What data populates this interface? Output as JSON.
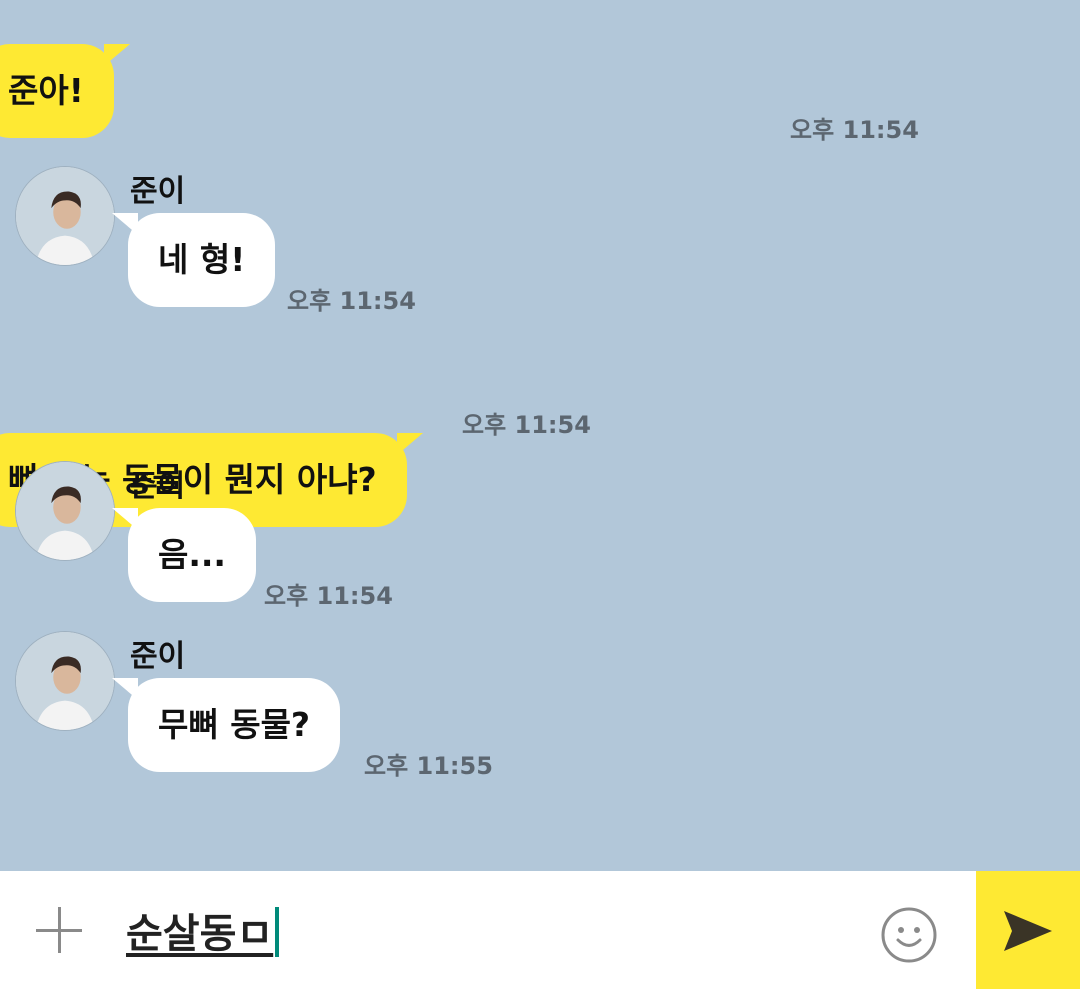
{
  "messages": [
    {
      "dir": "out",
      "text": "준아!",
      "time": "오후 11:54"
    },
    {
      "dir": "in",
      "sender": "준이",
      "text": "네 형!",
      "time": "오후 11:54"
    },
    {
      "dir": "out",
      "text": "뼈 없는 동물이 뭔지 아냐?",
      "time": "오후 11:54"
    },
    {
      "dir": "in",
      "sender": "준이",
      "text": "음...",
      "time": "오후 11:54"
    },
    {
      "dir": "in",
      "sender": "준이",
      "text": "무뼈 동물?",
      "time": "오후 11:55"
    }
  ],
  "input": {
    "value": "순살동ㅁ"
  },
  "icons": {
    "attach": "plus-icon",
    "emoji": "emoji-icon",
    "send": "send-icon"
  },
  "colors": {
    "background": "#b2c7d9",
    "my_bubble": "#fee933",
    "their_bubble": "#ffffff",
    "send_button": "#fee933"
  }
}
